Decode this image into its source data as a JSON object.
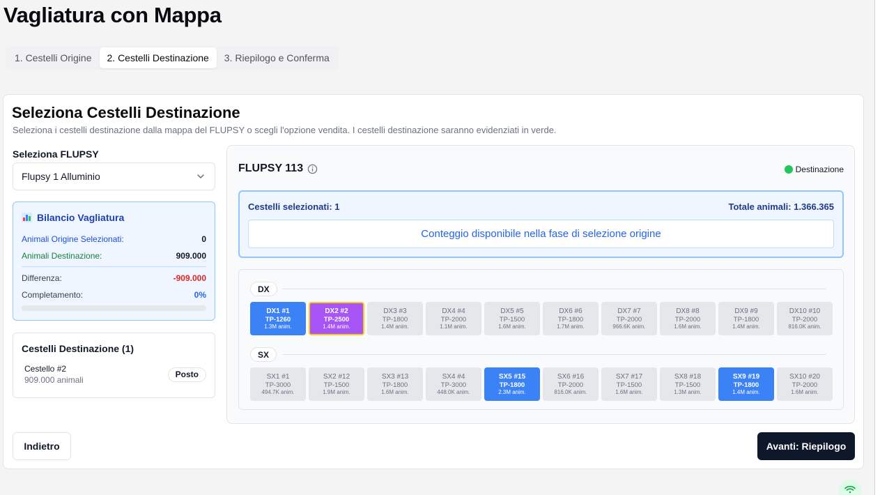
{
  "page": {
    "title": "Vagliatura con Mappa"
  },
  "tabs": [
    {
      "label": "1. Cestelli Origine",
      "active": false
    },
    {
      "label": "2. Cestelli Destinazione",
      "active": true
    },
    {
      "label": "3. Riepilogo e Conferma",
      "active": false
    }
  ],
  "card": {
    "title": "Seleziona Cestelli Destinazione",
    "description": "Seleziona i cestelli destinazione dalla mappa del FLUPSY o scegli l'opzione vendita. I cestelli destinazione saranno evidenziati in verde."
  },
  "flupsy_select": {
    "label": "Seleziona FLUPSY",
    "value": "Flupsy 1 Alluminio"
  },
  "bilancio": {
    "title": "Bilancio Vagliatura",
    "icon": "bar-chart-icon",
    "origine_label": "Animali Origine Selezionati:",
    "origine_value": "0",
    "destinazione_label": "Animali Destinazione:",
    "destinazione_value": "909.000",
    "differenza_label": "Differenza:",
    "differenza_value": "-909.000",
    "completamento_label": "Completamento:",
    "completamento_value": "0%",
    "progress": 0
  },
  "destinazioni": {
    "title": "Cestelli Destinazione (1)",
    "items": [
      {
        "name": "Cestello #2",
        "count": "909.000 animali",
        "badge": "Posto"
      }
    ]
  },
  "map": {
    "title": "FLUPSY 113",
    "legend_label": "Destinazione",
    "legend_color": "#22c55e",
    "selected_label": "Cestelli selezionati: 1",
    "total_label": "Totale animali: 1.366.365",
    "count_message": "Conteggio disponibile nella fase di selezione origine",
    "rows": [
      {
        "tag": "DX",
        "baskets": [
          {
            "name": "DX1 #1",
            "type": "TP-1260",
            "animals": "1.3M anim.",
            "state": "sel-blue"
          },
          {
            "name": "DX2 #2",
            "type": "TP-2500",
            "animals": "1.4M anim.",
            "state": "sel-purple"
          },
          {
            "name": "DX3 #3",
            "type": "TP-1800",
            "animals": "1.4M anim.",
            "state": ""
          },
          {
            "name": "DX4 #4",
            "type": "TP-2000",
            "animals": "1.1M anim.",
            "state": ""
          },
          {
            "name": "DX5 #5",
            "type": "TP-1500",
            "animals": "1.6M anim.",
            "state": ""
          },
          {
            "name": "DX6 #6",
            "type": "TP-1800",
            "animals": "1.7M anim.",
            "state": ""
          },
          {
            "name": "DX7 #7",
            "type": "TP-2000",
            "animals": "966.6K anim.",
            "state": ""
          },
          {
            "name": "DX8 #8",
            "type": "TP-2000",
            "animals": "1.6M anim.",
            "state": ""
          },
          {
            "name": "DX9 #9",
            "type": "TP-1800",
            "animals": "1.4M anim.",
            "state": ""
          },
          {
            "name": "DX10 #10",
            "type": "TP-2000",
            "animals": "816.0K anim.",
            "state": ""
          }
        ]
      },
      {
        "tag": "SX",
        "baskets": [
          {
            "name": "SX1 #1",
            "type": "TP-3000",
            "animals": "494.7K anim.",
            "state": ""
          },
          {
            "name": "SX2 #12",
            "type": "TP-1500",
            "animals": "1.9M anim.",
            "state": ""
          },
          {
            "name": "SX3 #13",
            "type": "TP-1800",
            "animals": "1.6M anim.",
            "state": ""
          },
          {
            "name": "SX4 #4",
            "type": "TP-3000",
            "animals": "448.0K anim.",
            "state": ""
          },
          {
            "name": "SX5 #15",
            "type": "TP-1800",
            "animals": "2.3M anim.",
            "state": "sel-blue"
          },
          {
            "name": "SX6 #16",
            "type": "TP-2000",
            "animals": "816.0K anim.",
            "state": ""
          },
          {
            "name": "SX7 #17",
            "type": "TP-1500",
            "animals": "1.6M anim.",
            "state": ""
          },
          {
            "name": "SX8 #18",
            "type": "TP-1500",
            "animals": "1.3M anim.",
            "state": ""
          },
          {
            "name": "SX9 #19",
            "type": "TP-1800",
            "animals": "1.4M anim.",
            "state": "sel-blue"
          },
          {
            "name": "SX10 #20",
            "type": "TP-2000",
            "animals": "1.6M anim.",
            "state": ""
          }
        ]
      }
    ]
  },
  "actions": {
    "back_label": "Indietro",
    "next_label": "Avanti: Riepilogo"
  },
  "status": {
    "icon": "wifi-icon",
    "color": "#16a34a"
  },
  "colors": {
    "selected_blue": "#3b82f6",
    "selected_purple": "#a855f7",
    "highlight_border": "#facc15",
    "primary_dark": "#0f172a",
    "negative": "#dc2626"
  }
}
